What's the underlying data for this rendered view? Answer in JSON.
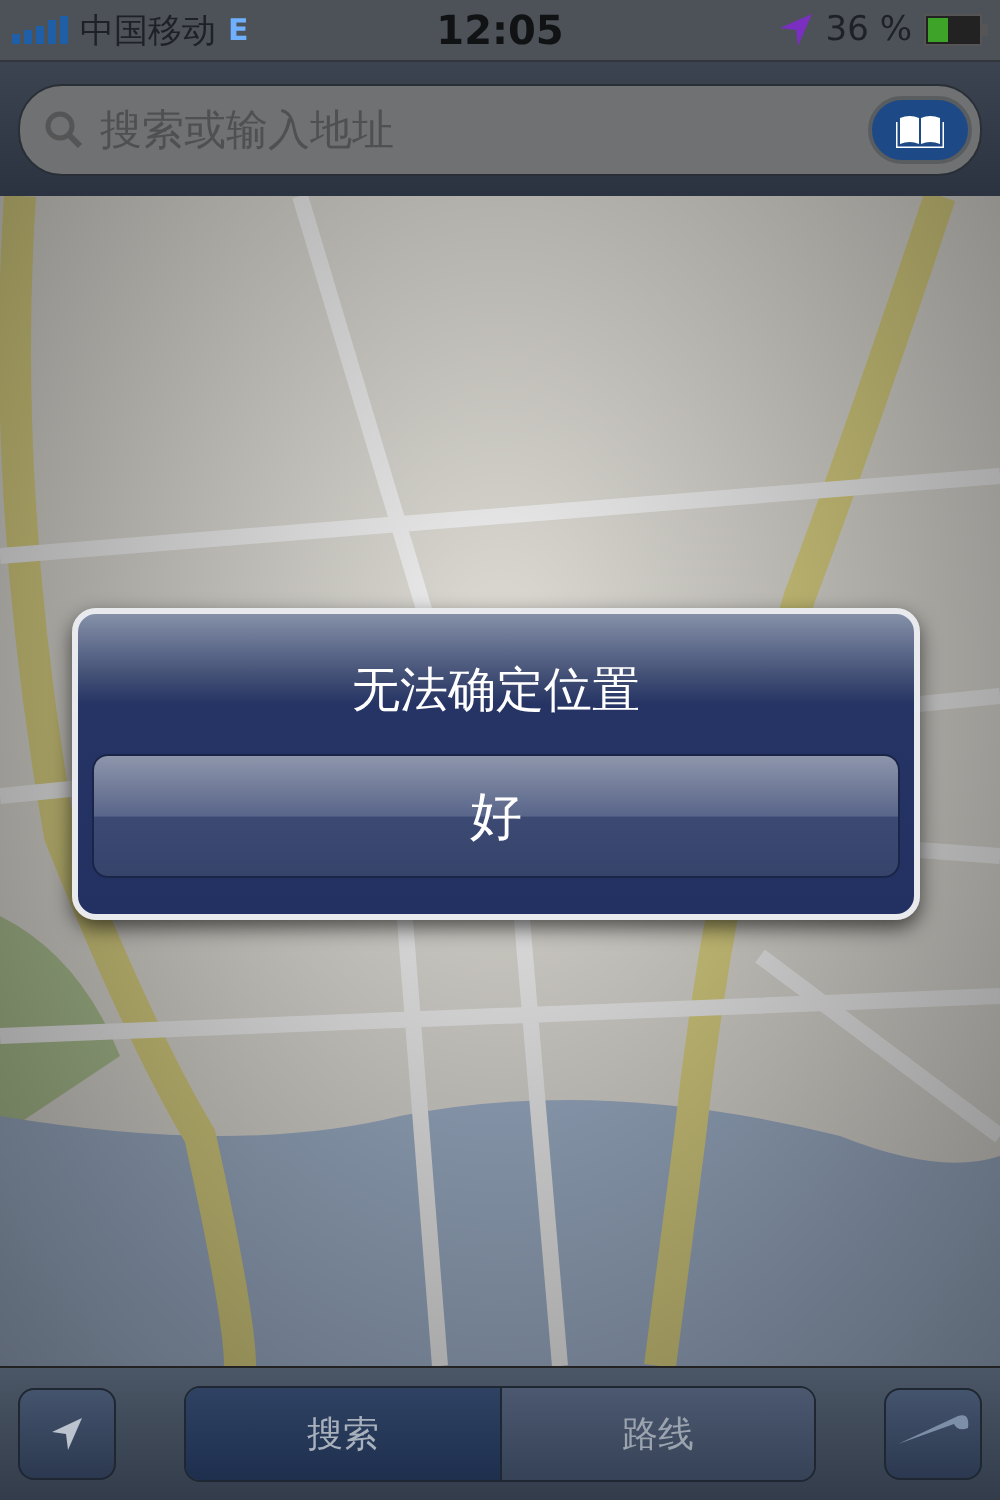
{
  "status_bar": {
    "carrier": "中国移动",
    "network": "E",
    "time": "12:05",
    "battery": "36 %"
  },
  "search": {
    "placeholder": "搜索或输入地址"
  },
  "alert": {
    "title": "无法确定位置",
    "buttons": [
      "好"
    ]
  },
  "toolbar": {
    "segments": [
      {
        "label": "搜索",
        "selected": true
      },
      {
        "label": "路线",
        "selected": false
      }
    ]
  }
}
